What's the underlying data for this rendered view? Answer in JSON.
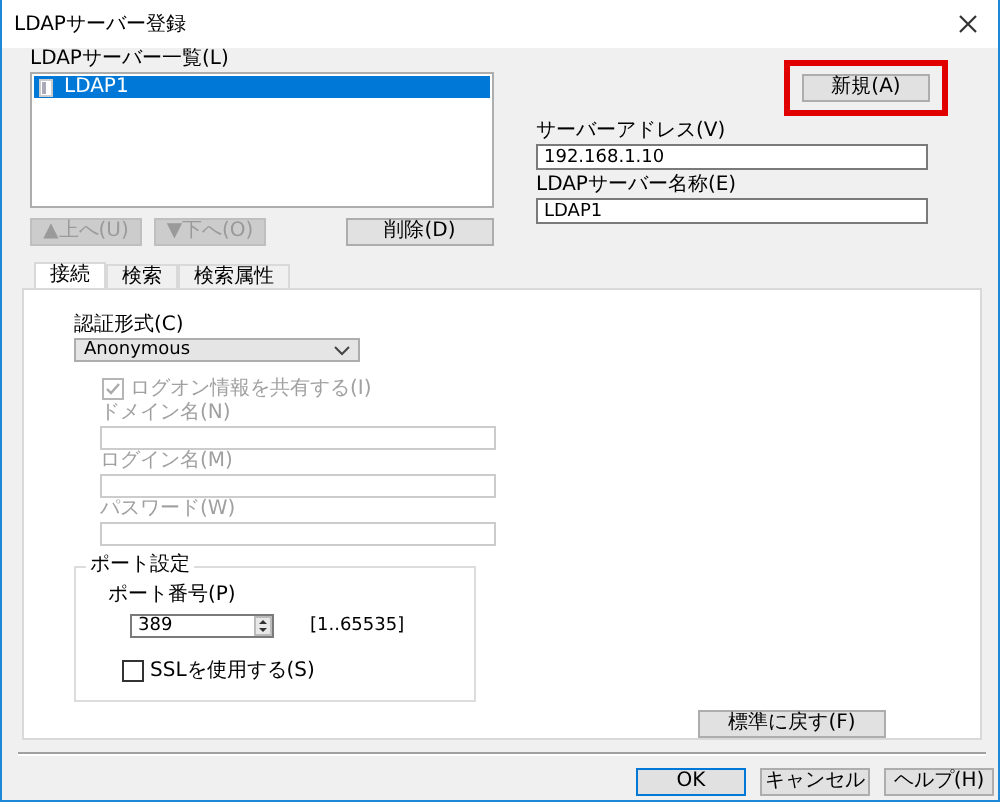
{
  "window": {
    "title": "LDAPサーバー登録"
  },
  "server_list": {
    "label": "LDAPサーバー一覧(L)",
    "items": [
      {
        "name": "LDAP1",
        "selected": true
      }
    ]
  },
  "list_buttons": [
    {
      "label": "▲上へ(U)",
      "disabled": true
    },
    {
      "label": "▼下へ(O)",
      "disabled": true
    },
    {
      "label": "削除(D)",
      "disabled": false
    }
  ],
  "new_button": {
    "label": "新規(A)",
    "highlighted": true
  },
  "server_address": {
    "label": "サーバーアドレス(V)",
    "value": "192.168.1.10"
  },
  "server_name": {
    "label": "LDAPサーバー名称(E)",
    "value": "LDAP1"
  },
  "tabs": [
    {
      "label": "接続",
      "selected": true
    },
    {
      "label": "検索",
      "selected": false
    },
    {
      "label": "検索属性",
      "selected": false
    }
  ],
  "auth": {
    "label": "認証形式(C)",
    "value": "Anonymous"
  },
  "share_logon": {
    "label": "ログオン情報を共有する(I)",
    "checked": true,
    "disabled": true
  },
  "credentials": [
    {
      "label": "ドメイン名(N)",
      "disabled": true
    },
    {
      "label": "ログイン名(M)",
      "disabled": true
    },
    {
      "label": "パスワード(W)",
      "disabled": true
    }
  ],
  "port_group": {
    "title": "ポート設定",
    "port_label": "ポート番号(P)",
    "port_value": "389",
    "range": "[1..65535]",
    "ssl": {
      "label": "SSLを使用する(S)",
      "checked": false
    }
  },
  "reset_button": {
    "label": "標準に戻す(F)"
  },
  "buttons": [
    {
      "label": "OK",
      "default": true
    },
    {
      "label": "キャンセル",
      "default": false
    },
    {
      "label": "ヘルプ(H)",
      "default": false
    }
  ]
}
